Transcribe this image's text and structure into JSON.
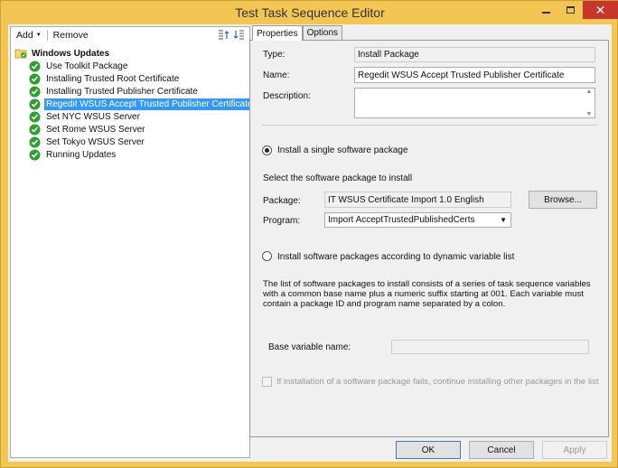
{
  "window": {
    "title": "Test Task Sequence Editor",
    "close_glyph": "✕"
  },
  "toolbar": {
    "add_label": "Add",
    "remove_label": "Remove"
  },
  "tree": {
    "root": "Windows Updates",
    "items": [
      {
        "label": "Use Toolkit Package",
        "selected": false
      },
      {
        "label": "Installing Trusted Root Certificate",
        "selected": false
      },
      {
        "label": "Installing Trusted Publisher Certificate",
        "selected": false
      },
      {
        "label": "Regedit WSUS Accept Trusted Publisher Certificate",
        "selected": true
      },
      {
        "label": "Set NYC WSUS Server",
        "selected": false
      },
      {
        "label": "Set Rome WSUS Server",
        "selected": false
      },
      {
        "label": "Set Tokyo WSUS Server",
        "selected": false
      },
      {
        "label": "Running Updates",
        "selected": false
      }
    ]
  },
  "tabs": [
    {
      "label": "Properties",
      "active": true
    },
    {
      "label": "Options",
      "active": false
    }
  ],
  "properties": {
    "type_label": "Type:",
    "type_value": "Install Package",
    "name_label": "Name:",
    "name_value": "Regedit WSUS Accept Trusted Publisher Certificate",
    "description_label": "Description:",
    "description_value": "",
    "radio_single_label": "Install a single software package",
    "radio_single_checked": true,
    "select_package_text": "Select the software package to install",
    "package_label": "Package:",
    "package_value": "IT WSUS Certificate Import 1.0 English",
    "browse_label": "Browse...",
    "program_label": "Program:",
    "program_value": "Import AcceptTrustedPublishedCerts",
    "radio_dynamic_label": "Install software packages according to dynamic variable list",
    "radio_dynamic_checked": false,
    "dynamic_para_1": "The list of software packages to install consists of a series of task sequence variables",
    "dynamic_para_2": "with a common base name plus a numeric suffix starting at 001.  Each variable must",
    "dynamic_para_3": "contain a package ID and program name separated by a colon.",
    "base_variable_label": "Base variable name:",
    "base_variable_value": "",
    "continue_label": "If installation of a software package fails, continue installing other packages in the list",
    "continue_checked": false
  },
  "footer": {
    "ok_label": "OK",
    "cancel_label": "Cancel",
    "apply_label": "Apply"
  },
  "colors": {
    "frame": "#f3c552",
    "selection": "#3399ff",
    "check_green": "#2e9e2e",
    "close_red": "#c7362b"
  }
}
